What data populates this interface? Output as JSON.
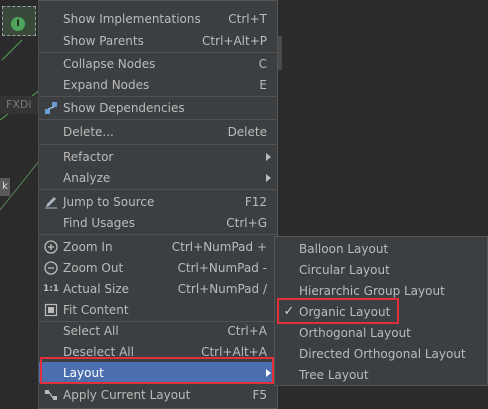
{
  "background": {
    "node_badge": "I",
    "label_fx": "FXDi",
    "label_k": "k"
  },
  "menu": {
    "items": [
      {
        "label": "Show Implementations",
        "shortcut": "Ctrl+T",
        "icon": ""
      },
      {
        "label": "Show Parents",
        "shortcut": "Ctrl+Alt+P",
        "icon": ""
      },
      {
        "label": "Collapse Nodes",
        "shortcut": "C",
        "icon": ""
      },
      {
        "label": "Expand Nodes",
        "shortcut": "E",
        "icon": ""
      },
      {
        "label": "Show Dependencies",
        "shortcut": "",
        "icon": "dependencies-icon"
      },
      {
        "label": "Delete...",
        "shortcut": "Delete",
        "icon": ""
      },
      {
        "label": "Refactor",
        "shortcut": "",
        "icon": "",
        "submenu": true
      },
      {
        "label": "Analyze",
        "shortcut": "",
        "icon": "",
        "submenu": true
      },
      {
        "label": "Jump to Source",
        "shortcut": "F12",
        "icon": "edit-pencil-icon"
      },
      {
        "label": "Find Usages",
        "shortcut": "Ctrl+G",
        "icon": ""
      },
      {
        "label": "Zoom In",
        "shortcut": "Ctrl+NumPad +",
        "icon": "zoom-in-icon"
      },
      {
        "label": "Zoom Out",
        "shortcut": "Ctrl+NumPad -",
        "icon": "zoom-out-icon"
      },
      {
        "label": "Actual Size",
        "shortcut": "Ctrl+NumPad /",
        "icon": "actual-size-icon"
      },
      {
        "label": "Fit Content",
        "shortcut": "",
        "icon": "fit-content-icon"
      },
      {
        "label": "Select All",
        "shortcut": "Ctrl+A",
        "icon": ""
      },
      {
        "label": "Deselect All",
        "shortcut": "Ctrl+Alt+A",
        "icon": ""
      },
      {
        "label": "Layout",
        "shortcut": "",
        "icon": "",
        "submenu": true,
        "selected": true
      },
      {
        "label": "Apply Current Layout",
        "shortcut": "F5",
        "icon": "apply-layout-icon"
      }
    ],
    "icon_text": {
      "actual_size": "1:1"
    }
  },
  "layout_submenu": {
    "items": [
      {
        "label": "Balloon Layout",
        "checked": false
      },
      {
        "label": "Circular Layout",
        "checked": false
      },
      {
        "label": "Hierarchic Group Layout",
        "checked": false
      },
      {
        "label": "Organic Layout",
        "checked": true
      },
      {
        "label": "Orthogonal Layout",
        "checked": false
      },
      {
        "label": "Directed Orthogonal Layout",
        "checked": false
      },
      {
        "label": "Tree Layout",
        "checked": false
      }
    ],
    "check_mark": "✓"
  },
  "colors": {
    "menu_bg": "#3c3f41",
    "selected_bg": "#4b6eaf",
    "highlight_box": "#e0303a",
    "text": "#bbbbbb"
  }
}
